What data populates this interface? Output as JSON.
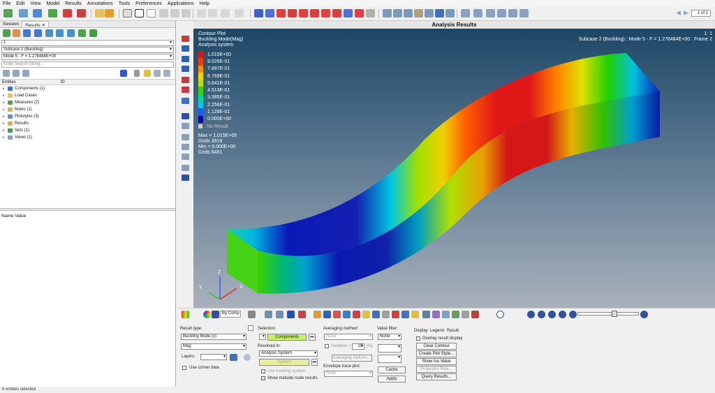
{
  "menu": [
    "File",
    "Edit",
    "View",
    "Model",
    "Results",
    "Annotations",
    "Tools",
    "Preferences",
    "Applications",
    "Help"
  ],
  "pager": {
    "value": "1 of 1"
  },
  "left_panel": {
    "tabs": [
      "Session",
      "Results"
    ],
    "close_glyph": "✕",
    "dropdown_page": "1",
    "dropdown_subcase": "Subcase 2 (Buckling)",
    "dropdown_mode": "Mode 5 - F = 1.278484E+00",
    "search_placeholder": "Enter Search String...",
    "entities_header": "Entities",
    "id_header": "ID",
    "tree": [
      {
        "label": "Components (1)",
        "color": "#2a7ad0"
      },
      {
        "label": "Load Cases",
        "color": "#e8c060"
      },
      {
        "label": "Measures (2)",
        "color": "#5a9a5a"
      },
      {
        "label": "Notes (1)",
        "color": "#d0b060"
      },
      {
        "label": "Plotstyles (3)",
        "color": "#6090c0"
      },
      {
        "label": "Results",
        "color": "#e0b050"
      },
      {
        "label": "Sets (1)",
        "color": "#40a040"
      },
      {
        "label": "Views (1)",
        "color": "#80a0d0"
      }
    ],
    "name_value_header": "Name Value"
  },
  "status_text": "0 entities selected",
  "viewport": {
    "title": "Analysis Results",
    "plot_title": "Contour Plot",
    "plot_subtitle": "Buckling Mode(Mag)",
    "plot_system": "Analysis system",
    "frame_ratio": "1: 1",
    "frame_info": "Subcase 2 (Buckling) : Mode 5 - F = 1.278484E+00 : Frame 2",
    "legend": [
      {
        "value": "1.015E+00",
        "color": "#d41818"
      },
      {
        "value": "9.026E-01",
        "color": "#ff3a00"
      },
      {
        "value": "7.897E-01",
        "color": "#ff8c00"
      },
      {
        "value": "6.769E-01",
        "color": "#f2d600"
      },
      {
        "value": "5.641E-01",
        "color": "#b2e000"
      },
      {
        "value": "4.513E-01",
        "color": "#3cd200"
      },
      {
        "value": "3.385E-01",
        "color": "#00d890"
      },
      {
        "value": "2.256E-01",
        "color": "#00c8e8"
      },
      {
        "value": "1.128E-01",
        "color": "#1060ff"
      },
      {
        "value": "0.000E+00",
        "color": "#0a0a9a"
      }
    ],
    "no_result": "No Result",
    "max_label": "Max = 1.015E+00",
    "max_grid": "Grids 3919",
    "min_label": "Min = 0.000E+00",
    "min_grid": "Grids 6481",
    "axis_z": "Z",
    "axis_y": "Y",
    "axis_x": "X"
  },
  "bottom_toolbar": {
    "by_comp": "By Comp"
  },
  "bottom_panel": {
    "result_type_label": "Result type:",
    "result_type_value": "Buckling Mode (v)",
    "component_value": "Mag",
    "layers_label": "Layers:",
    "use_corner_data": "Use corner data",
    "selection_label": "Selection:",
    "components_button": "Components",
    "resolved_in_label": "Resolved in:",
    "resolved_in_value": "Analysis System",
    "system_button": "System",
    "use_tracking": "Use tracking system",
    "show_midside": "Show midside node results",
    "averaging_label": "Averaging method:",
    "averaging_value": "None",
    "variation_label": "Variation <",
    "variation_value": "10",
    "variation_unit": "[%]",
    "averaging_options": "Averaging Options...",
    "envelope_label": "Envelope trace plot:",
    "envelope_value": "None",
    "value_filter_label": "Value filter:",
    "value_filter_value": "None",
    "cache_button": "Cache",
    "apply_button": "Apply",
    "right_tabs": [
      "Display",
      "Legend",
      "Result"
    ],
    "overlay_label": "Overlay result display",
    "clear_contour": "Clear Contour",
    "create_plot_style": "Create Plot Style...",
    "show_iso_value": "Show Iso Value",
    "projection_rule": "Projection Rule...",
    "query_results": "Query Results..."
  }
}
